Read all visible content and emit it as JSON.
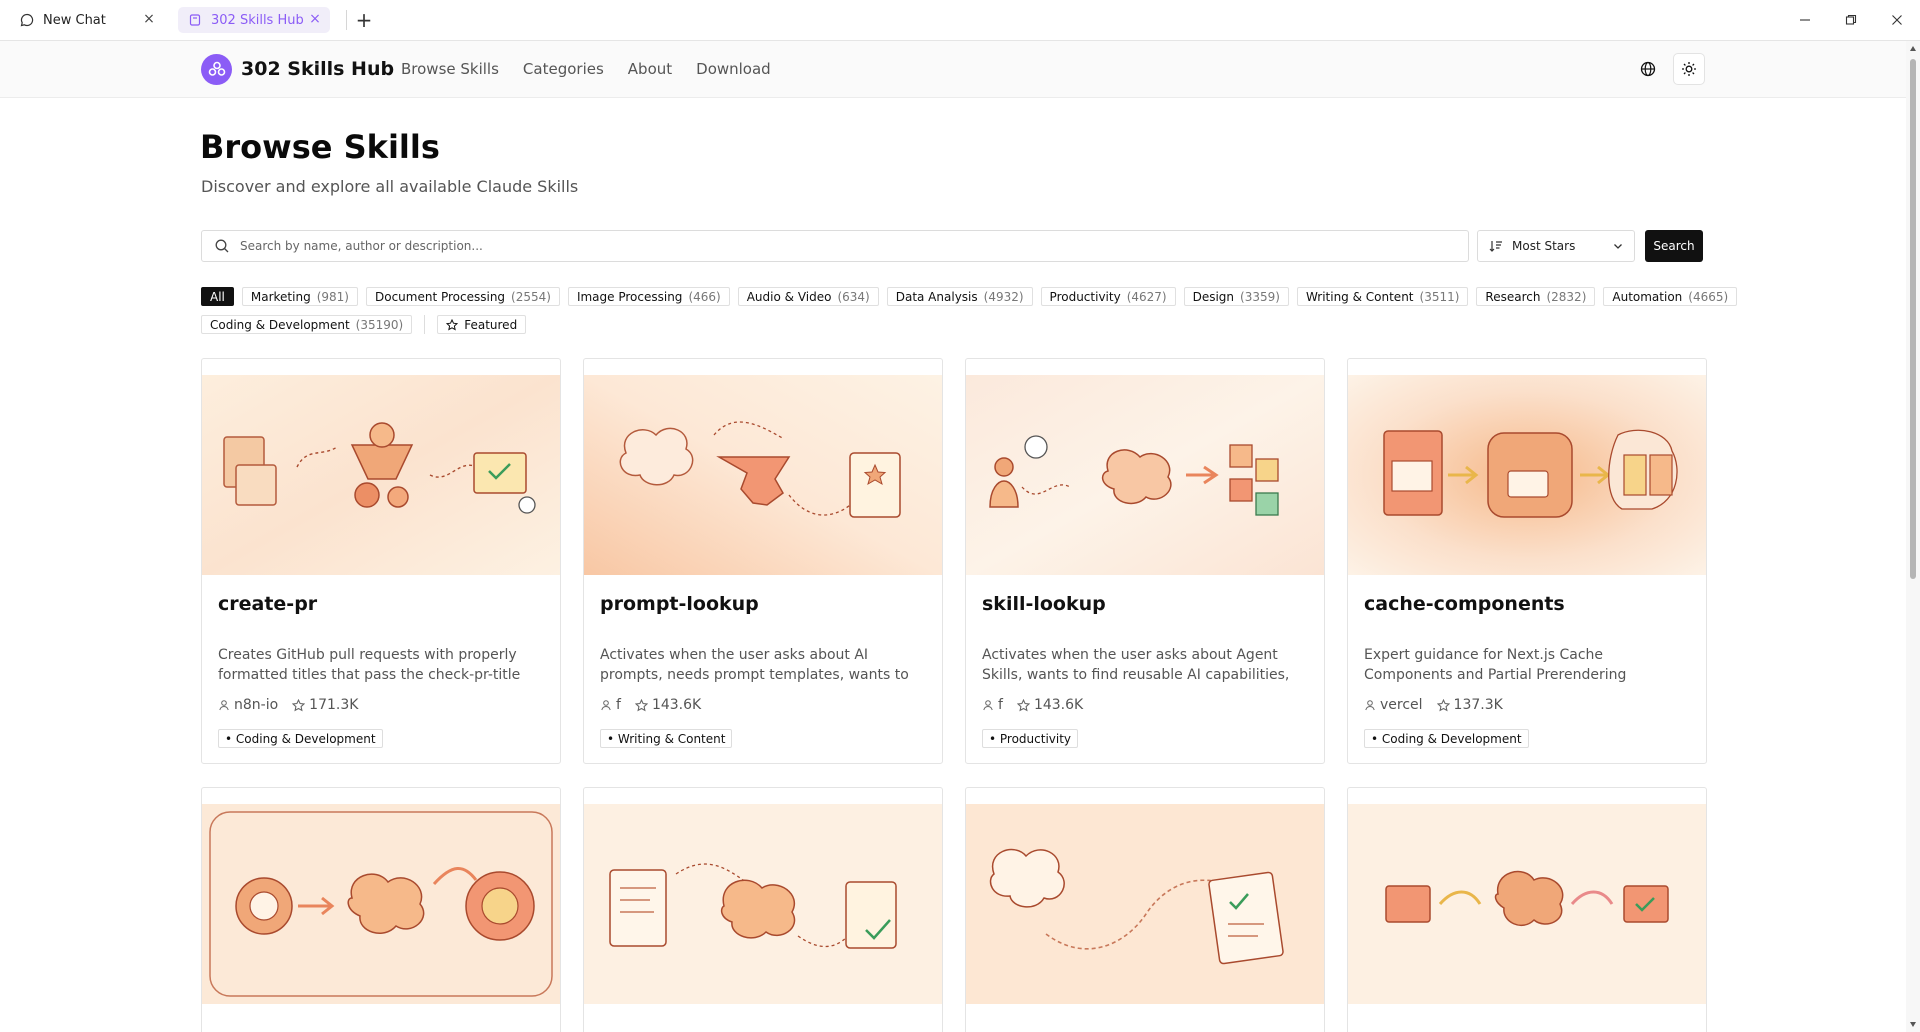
{
  "browser": {
    "tabs": [
      {
        "label": "New Chat",
        "active": false
      },
      {
        "label": "302 Skills Hub",
        "active": true
      }
    ]
  },
  "header": {
    "brand": "302 Skills Hub",
    "nav": [
      "Browse Skills",
      "Categories",
      "About",
      "Download"
    ]
  },
  "page": {
    "title": "Browse Skills",
    "subtitle": "Discover and explore all available Claude Skills"
  },
  "search": {
    "placeholder": "Search by name, author or description...",
    "sort_value": "Most Stars",
    "button_label": "Search"
  },
  "categories": [
    {
      "label": "All",
      "count": "",
      "active": true
    },
    {
      "label": "Marketing",
      "count": "(981)"
    },
    {
      "label": "Document Processing",
      "count": "(2554)"
    },
    {
      "label": "Image Processing",
      "count": "(466)"
    },
    {
      "label": "Audio & Video",
      "count": "(634)"
    },
    {
      "label": "Data Analysis",
      "count": "(4932)"
    },
    {
      "label": "Productivity",
      "count": "(4627)"
    },
    {
      "label": "Design",
      "count": "(3359)"
    },
    {
      "label": "Writing & Content",
      "count": "(3511)"
    },
    {
      "label": "Research",
      "count": "(2832)"
    },
    {
      "label": "Automation",
      "count": "(4665)"
    },
    {
      "label": "Coding & Development",
      "count": "(35190)"
    }
  ],
  "featured_label": "Featured",
  "cards": [
    {
      "title": "create-pr",
      "description": "Creates GitHub pull requests with properly formatted titles that pass the check-pr-title CI...",
      "author": "n8n-io",
      "stars": "171.3K",
      "tag": "• Coding & Development"
    },
    {
      "title": "prompt-lookup",
      "description": "Activates when the user asks about AI prompts, needs prompt templates, wants to search for...",
      "author": "f",
      "stars": "143.6K",
      "tag": "• Writing & Content"
    },
    {
      "title": "skill-lookup",
      "description": "Activates when the user asks about Agent Skills, wants to find reusable AI capabilities, needs to...",
      "author": "f",
      "stars": "143.6K",
      "tag": "• Productivity"
    },
    {
      "title": "cache-components",
      "description": "Expert guidance for Next.js Cache Components and Partial Prerendering (PPR).**PROACTIVE...",
      "author": "vercel",
      "stars": "137.3K",
      "tag": "• Coding & Development"
    }
  ],
  "colors": {
    "accent": "#8b5cf6",
    "primary_button": "#111111",
    "illustration_warm": "#f6b98a"
  }
}
